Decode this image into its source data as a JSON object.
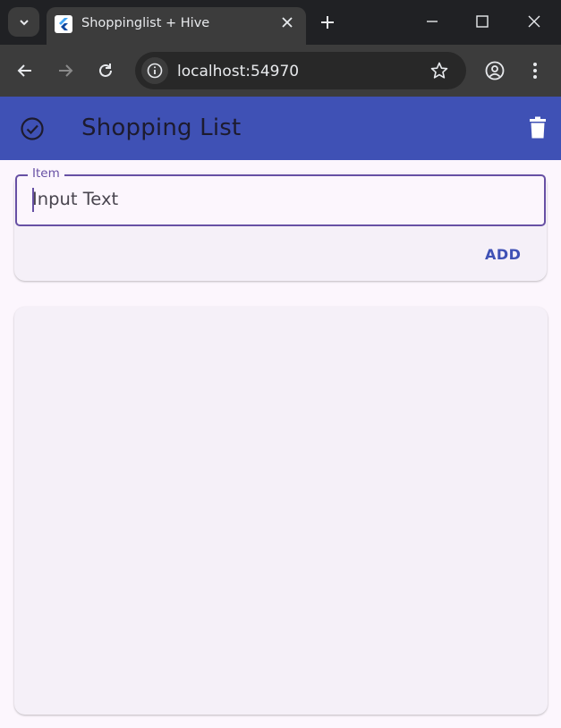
{
  "browser": {
    "tab_title": "Shoppinglist + Hive",
    "url": "localhost:54970"
  },
  "app": {
    "title": "Shopping List",
    "field_label": "Item",
    "field_value": "Input Text",
    "add_label": "ADD",
    "items": []
  },
  "colors": {
    "appbar": "#3f51b5",
    "accent": "#6750a4",
    "background": "#fcf6fd",
    "card": "#f5f0f8"
  }
}
